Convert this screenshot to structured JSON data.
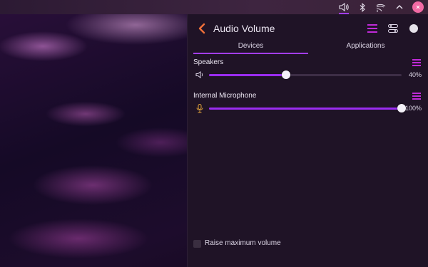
{
  "colors": {
    "accent": "#a33df2",
    "back_arrow": "#f0703a",
    "avatar": "#f26aa4",
    "panel_bg": "#1f1326"
  },
  "topbar": {
    "icons": [
      "speaker-icon",
      "bluetooth-icon",
      "wifi-icon",
      "chevron-up-icon",
      "user-avatar"
    ]
  },
  "panel": {
    "title": "Audio Volume",
    "tabs": [
      {
        "label": "Devices",
        "active": true
      },
      {
        "label": "Applications",
        "active": false
      }
    ],
    "devices": [
      {
        "name": "Speakers",
        "icon": "speaker-icon",
        "volume": 40,
        "percent_label": "40%"
      },
      {
        "name": "Internal Microphone",
        "icon": "microphone-icon",
        "volume": 100,
        "percent_label": "100%"
      }
    ],
    "raise_max_volume": {
      "label": "Raise maximum volume",
      "checked": false
    }
  }
}
